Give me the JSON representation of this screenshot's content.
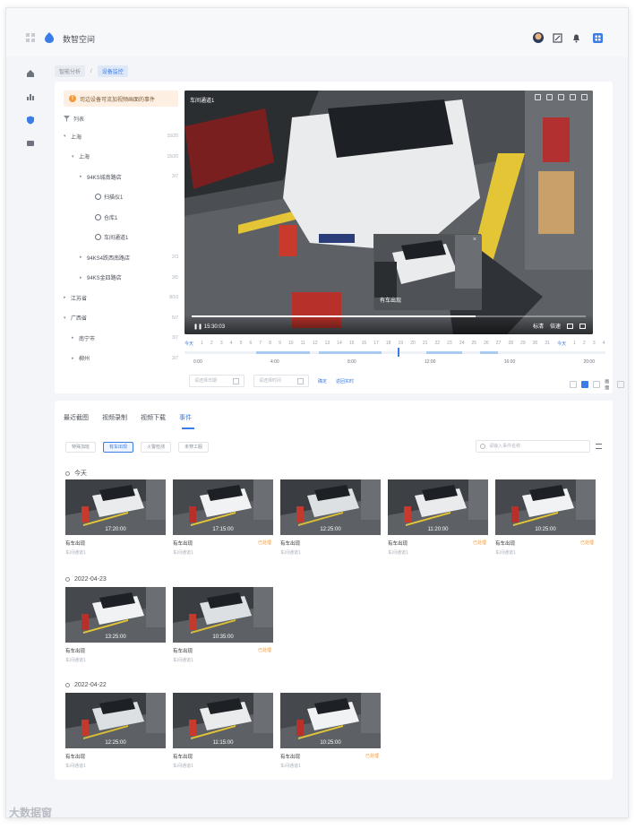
{
  "app": {
    "title": "数智空间"
  },
  "breadcrumb": [
    "智能分析",
    "设备监控"
  ],
  "notice": "司边设备可流加视频画面的事件",
  "tree": {
    "header": "列表",
    "header_count": "",
    "nodes": [
      {
        "label": "上海",
        "count": "15/20",
        "level": 0,
        "expand": "▾",
        "icon": ""
      },
      {
        "label": "上海",
        "count": "15/20",
        "level": 1,
        "expand": "▾",
        "icon": ""
      },
      {
        "label": "94KS城南路店",
        "count": "3/7",
        "level": 2,
        "expand": "▸",
        "icon": ""
      },
      {
        "label": "扫描仪1",
        "count": "",
        "level": 3,
        "expand": "",
        "icon": "camera-icon"
      },
      {
        "label": "仓库1",
        "count": "",
        "level": 3,
        "expand": "",
        "icon": "camera-icon"
      },
      {
        "label": "车间通道1",
        "count": "",
        "level": 3,
        "expand": "",
        "icon": "camera-icon"
      },
      {
        "label": "94KS4跌西南路店",
        "count": "2/3",
        "level": 2,
        "expand": "▸",
        "icon": ""
      },
      {
        "label": "94KS金四路店",
        "count": "3/5",
        "level": 2,
        "expand": "▸",
        "icon": ""
      },
      {
        "label": "江苏省",
        "count": "8/10",
        "level": 0,
        "expand": "▸",
        "icon": ""
      },
      {
        "label": "广西省",
        "count": "5/7",
        "level": 0,
        "expand": "▾",
        "icon": ""
      },
      {
        "label": "南宁市",
        "count": "3/7",
        "level": 1,
        "expand": "▸",
        "icon": ""
      },
      {
        "label": "柳州",
        "count": "3/7",
        "level": 1,
        "expand": "▸",
        "icon": ""
      }
    ]
  },
  "player": {
    "camera_name": "车间通道1",
    "time": "15:30:03",
    "controls": [
      "标清",
      "倍速"
    ],
    "pip_label": "有车出现",
    "progress": 0.72
  },
  "timeline": {
    "numbers": [
      "今天",
      "1",
      "2",
      "3",
      "4",
      "5",
      "6",
      "7",
      "8",
      "9",
      "10",
      "11",
      "12",
      "13",
      "14",
      "15",
      "16",
      "17",
      "18",
      "19",
      "20",
      "21",
      "22",
      "23",
      "24",
      "25",
      "26",
      "27",
      "28",
      "29",
      "30",
      "31",
      "今天",
      "1",
      "2",
      "3",
      "4"
    ],
    "hours": [
      "0:00",
      "4:00",
      "8:00",
      "12:00",
      "16:00",
      "20:00"
    ],
    "start_placeholder": "请选择日期",
    "end_placeholder": "请选择时间",
    "confirm": "确定",
    "back_live": "返回实时",
    "view_label": "画面"
  },
  "tabs": [
    "最近截图",
    "视频录制",
    "视频下载",
    "事件"
  ],
  "filters": [
    "特殊加班",
    "有车出现",
    "火警检测",
    "未穿工服"
  ],
  "search_placeholder": "请输入事件名称",
  "groups": [
    {
      "date": "今天",
      "items": [
        {
          "time": "17:20:00",
          "title": "有车出现",
          "camera": "车间通道1",
          "tag": ""
        },
        {
          "time": "17:15:00",
          "title": "有车出现",
          "camera": "车间通道1",
          "tag": "已处理"
        },
        {
          "time": "12:25:00",
          "title": "有车出现",
          "camera": "车间通道1",
          "tag": ""
        },
        {
          "time": "11:20:00",
          "title": "有车出现",
          "camera": "车间通道1",
          "tag": "已处理"
        },
        {
          "time": "10:25:00",
          "title": "有车出现",
          "camera": "车间通道1",
          "tag": "已处理"
        }
      ]
    },
    {
      "date": "2022-04-23",
      "items": [
        {
          "time": "13:25:00",
          "title": "有车出现",
          "camera": "车间通道1",
          "tag": ""
        },
        {
          "time": "10:35:00",
          "title": "有车出现",
          "camera": "车间通道1",
          "tag": "已处理"
        }
      ]
    },
    {
      "date": "2022-04-22",
      "items": [
        {
          "time": "12:25:00",
          "title": "有车出现",
          "camera": "车间通道1",
          "tag": ""
        },
        {
          "time": "11:15:00",
          "title": "有车出现",
          "camera": "车间通道1",
          "tag": ""
        },
        {
          "time": "10:25:00",
          "title": "有车出现",
          "camera": "车间通道1",
          "tag": "已处理"
        }
      ]
    }
  ],
  "watermark": "大数据窗"
}
